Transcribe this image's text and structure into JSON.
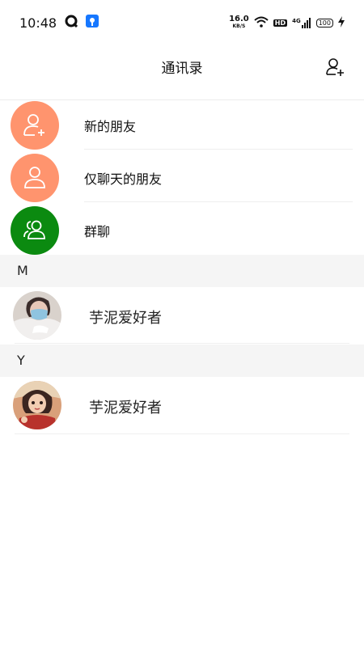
{
  "status_bar": {
    "time": "10:48",
    "net_speed_value": "16.0",
    "net_speed_unit": "KB/S",
    "hd_label": "HD",
    "signal_label": "4G",
    "battery": "100"
  },
  "header": {
    "title": "通讯录"
  },
  "functions": [
    {
      "label": "新的朋友",
      "color": "#FF946E",
      "icon": "add-friend-icon"
    },
    {
      "label": "仅聊天的朋友",
      "color": "#FF946E",
      "icon": "chat-only-friend-icon"
    },
    {
      "label": "群聊",
      "color": "#0B8A10",
      "icon": "group-chat-icon"
    }
  ],
  "sections": [
    {
      "letter": "M",
      "contacts": [
        {
          "name": "芋泥爱好者",
          "avatar": "masked-person-avatar"
        }
      ]
    },
    {
      "letter": "Y",
      "contacts": [
        {
          "name": "芋泥爱好者",
          "avatar": "cartoon-girl-avatar"
        }
      ]
    }
  ]
}
